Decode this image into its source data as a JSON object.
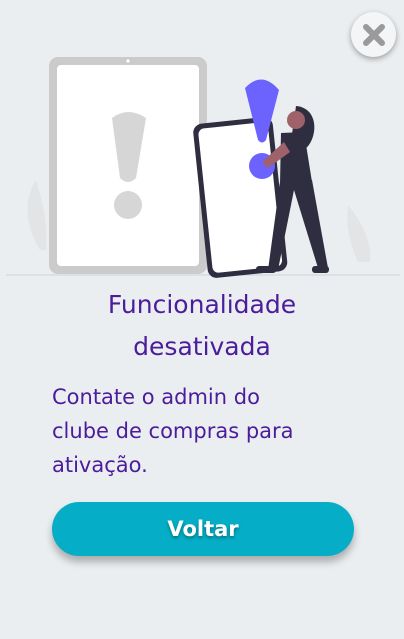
{
  "dialog": {
    "title_line1": "Funcionalidade",
    "title_line2": "desativada",
    "message_line1": "Contate o admin do",
    "message_line2": "clube de compras para",
    "message_line3": "ativação.",
    "back_button": "Voltar"
  },
  "icons": {
    "close": "close-icon",
    "illustration": "warning-illustration"
  },
  "colors": {
    "background": "#ebeef0",
    "text": "#4b1c9b",
    "button": "#05aec6",
    "accent": "#6c63ff"
  }
}
